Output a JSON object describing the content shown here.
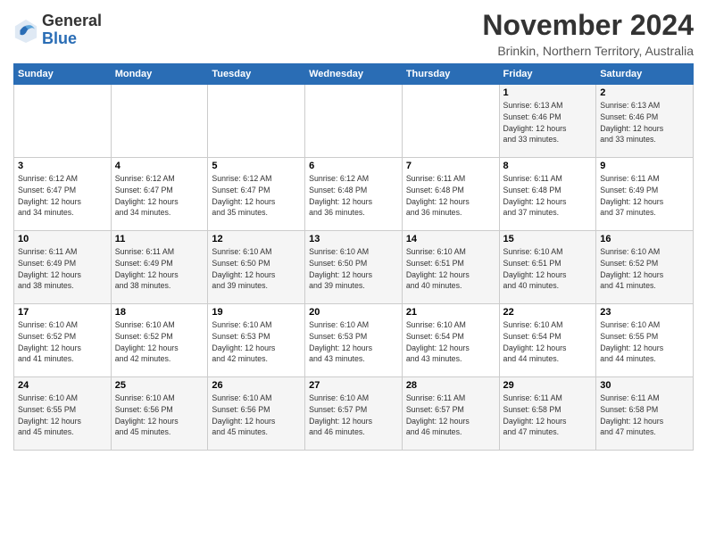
{
  "header": {
    "logo_general": "General",
    "logo_blue": "Blue",
    "month_title": "November 2024",
    "subtitle": "Brinkin, Northern Territory, Australia"
  },
  "days_of_week": [
    "Sunday",
    "Monday",
    "Tuesday",
    "Wednesday",
    "Thursday",
    "Friday",
    "Saturday"
  ],
  "weeks": [
    [
      {
        "day": "",
        "info": ""
      },
      {
        "day": "",
        "info": ""
      },
      {
        "day": "",
        "info": ""
      },
      {
        "day": "",
        "info": ""
      },
      {
        "day": "",
        "info": ""
      },
      {
        "day": "1",
        "info": "Sunrise: 6:13 AM\nSunset: 6:46 PM\nDaylight: 12 hours\nand 33 minutes."
      },
      {
        "day": "2",
        "info": "Sunrise: 6:13 AM\nSunset: 6:46 PM\nDaylight: 12 hours\nand 33 minutes."
      }
    ],
    [
      {
        "day": "3",
        "info": "Sunrise: 6:12 AM\nSunset: 6:47 PM\nDaylight: 12 hours\nand 34 minutes."
      },
      {
        "day": "4",
        "info": "Sunrise: 6:12 AM\nSunset: 6:47 PM\nDaylight: 12 hours\nand 34 minutes."
      },
      {
        "day": "5",
        "info": "Sunrise: 6:12 AM\nSunset: 6:47 PM\nDaylight: 12 hours\nand 35 minutes."
      },
      {
        "day": "6",
        "info": "Sunrise: 6:12 AM\nSunset: 6:48 PM\nDaylight: 12 hours\nand 36 minutes."
      },
      {
        "day": "7",
        "info": "Sunrise: 6:11 AM\nSunset: 6:48 PM\nDaylight: 12 hours\nand 36 minutes."
      },
      {
        "day": "8",
        "info": "Sunrise: 6:11 AM\nSunset: 6:48 PM\nDaylight: 12 hours\nand 37 minutes."
      },
      {
        "day": "9",
        "info": "Sunrise: 6:11 AM\nSunset: 6:49 PM\nDaylight: 12 hours\nand 37 minutes."
      }
    ],
    [
      {
        "day": "10",
        "info": "Sunrise: 6:11 AM\nSunset: 6:49 PM\nDaylight: 12 hours\nand 38 minutes."
      },
      {
        "day": "11",
        "info": "Sunrise: 6:11 AM\nSunset: 6:49 PM\nDaylight: 12 hours\nand 38 minutes."
      },
      {
        "day": "12",
        "info": "Sunrise: 6:10 AM\nSunset: 6:50 PM\nDaylight: 12 hours\nand 39 minutes."
      },
      {
        "day": "13",
        "info": "Sunrise: 6:10 AM\nSunset: 6:50 PM\nDaylight: 12 hours\nand 39 minutes."
      },
      {
        "day": "14",
        "info": "Sunrise: 6:10 AM\nSunset: 6:51 PM\nDaylight: 12 hours\nand 40 minutes."
      },
      {
        "day": "15",
        "info": "Sunrise: 6:10 AM\nSunset: 6:51 PM\nDaylight: 12 hours\nand 40 minutes."
      },
      {
        "day": "16",
        "info": "Sunrise: 6:10 AM\nSunset: 6:52 PM\nDaylight: 12 hours\nand 41 minutes."
      }
    ],
    [
      {
        "day": "17",
        "info": "Sunrise: 6:10 AM\nSunset: 6:52 PM\nDaylight: 12 hours\nand 41 minutes."
      },
      {
        "day": "18",
        "info": "Sunrise: 6:10 AM\nSunset: 6:52 PM\nDaylight: 12 hours\nand 42 minutes."
      },
      {
        "day": "19",
        "info": "Sunrise: 6:10 AM\nSunset: 6:53 PM\nDaylight: 12 hours\nand 42 minutes."
      },
      {
        "day": "20",
        "info": "Sunrise: 6:10 AM\nSunset: 6:53 PM\nDaylight: 12 hours\nand 43 minutes."
      },
      {
        "day": "21",
        "info": "Sunrise: 6:10 AM\nSunset: 6:54 PM\nDaylight: 12 hours\nand 43 minutes."
      },
      {
        "day": "22",
        "info": "Sunrise: 6:10 AM\nSunset: 6:54 PM\nDaylight: 12 hours\nand 44 minutes."
      },
      {
        "day": "23",
        "info": "Sunrise: 6:10 AM\nSunset: 6:55 PM\nDaylight: 12 hours\nand 44 minutes."
      }
    ],
    [
      {
        "day": "24",
        "info": "Sunrise: 6:10 AM\nSunset: 6:55 PM\nDaylight: 12 hours\nand 45 minutes."
      },
      {
        "day": "25",
        "info": "Sunrise: 6:10 AM\nSunset: 6:56 PM\nDaylight: 12 hours\nand 45 minutes."
      },
      {
        "day": "26",
        "info": "Sunrise: 6:10 AM\nSunset: 6:56 PM\nDaylight: 12 hours\nand 45 minutes."
      },
      {
        "day": "27",
        "info": "Sunrise: 6:10 AM\nSunset: 6:57 PM\nDaylight: 12 hours\nand 46 minutes."
      },
      {
        "day": "28",
        "info": "Sunrise: 6:11 AM\nSunset: 6:57 PM\nDaylight: 12 hours\nand 46 minutes."
      },
      {
        "day": "29",
        "info": "Sunrise: 6:11 AM\nSunset: 6:58 PM\nDaylight: 12 hours\nand 47 minutes."
      },
      {
        "day": "30",
        "info": "Sunrise: 6:11 AM\nSunset: 6:58 PM\nDaylight: 12 hours\nand 47 minutes."
      }
    ]
  ]
}
